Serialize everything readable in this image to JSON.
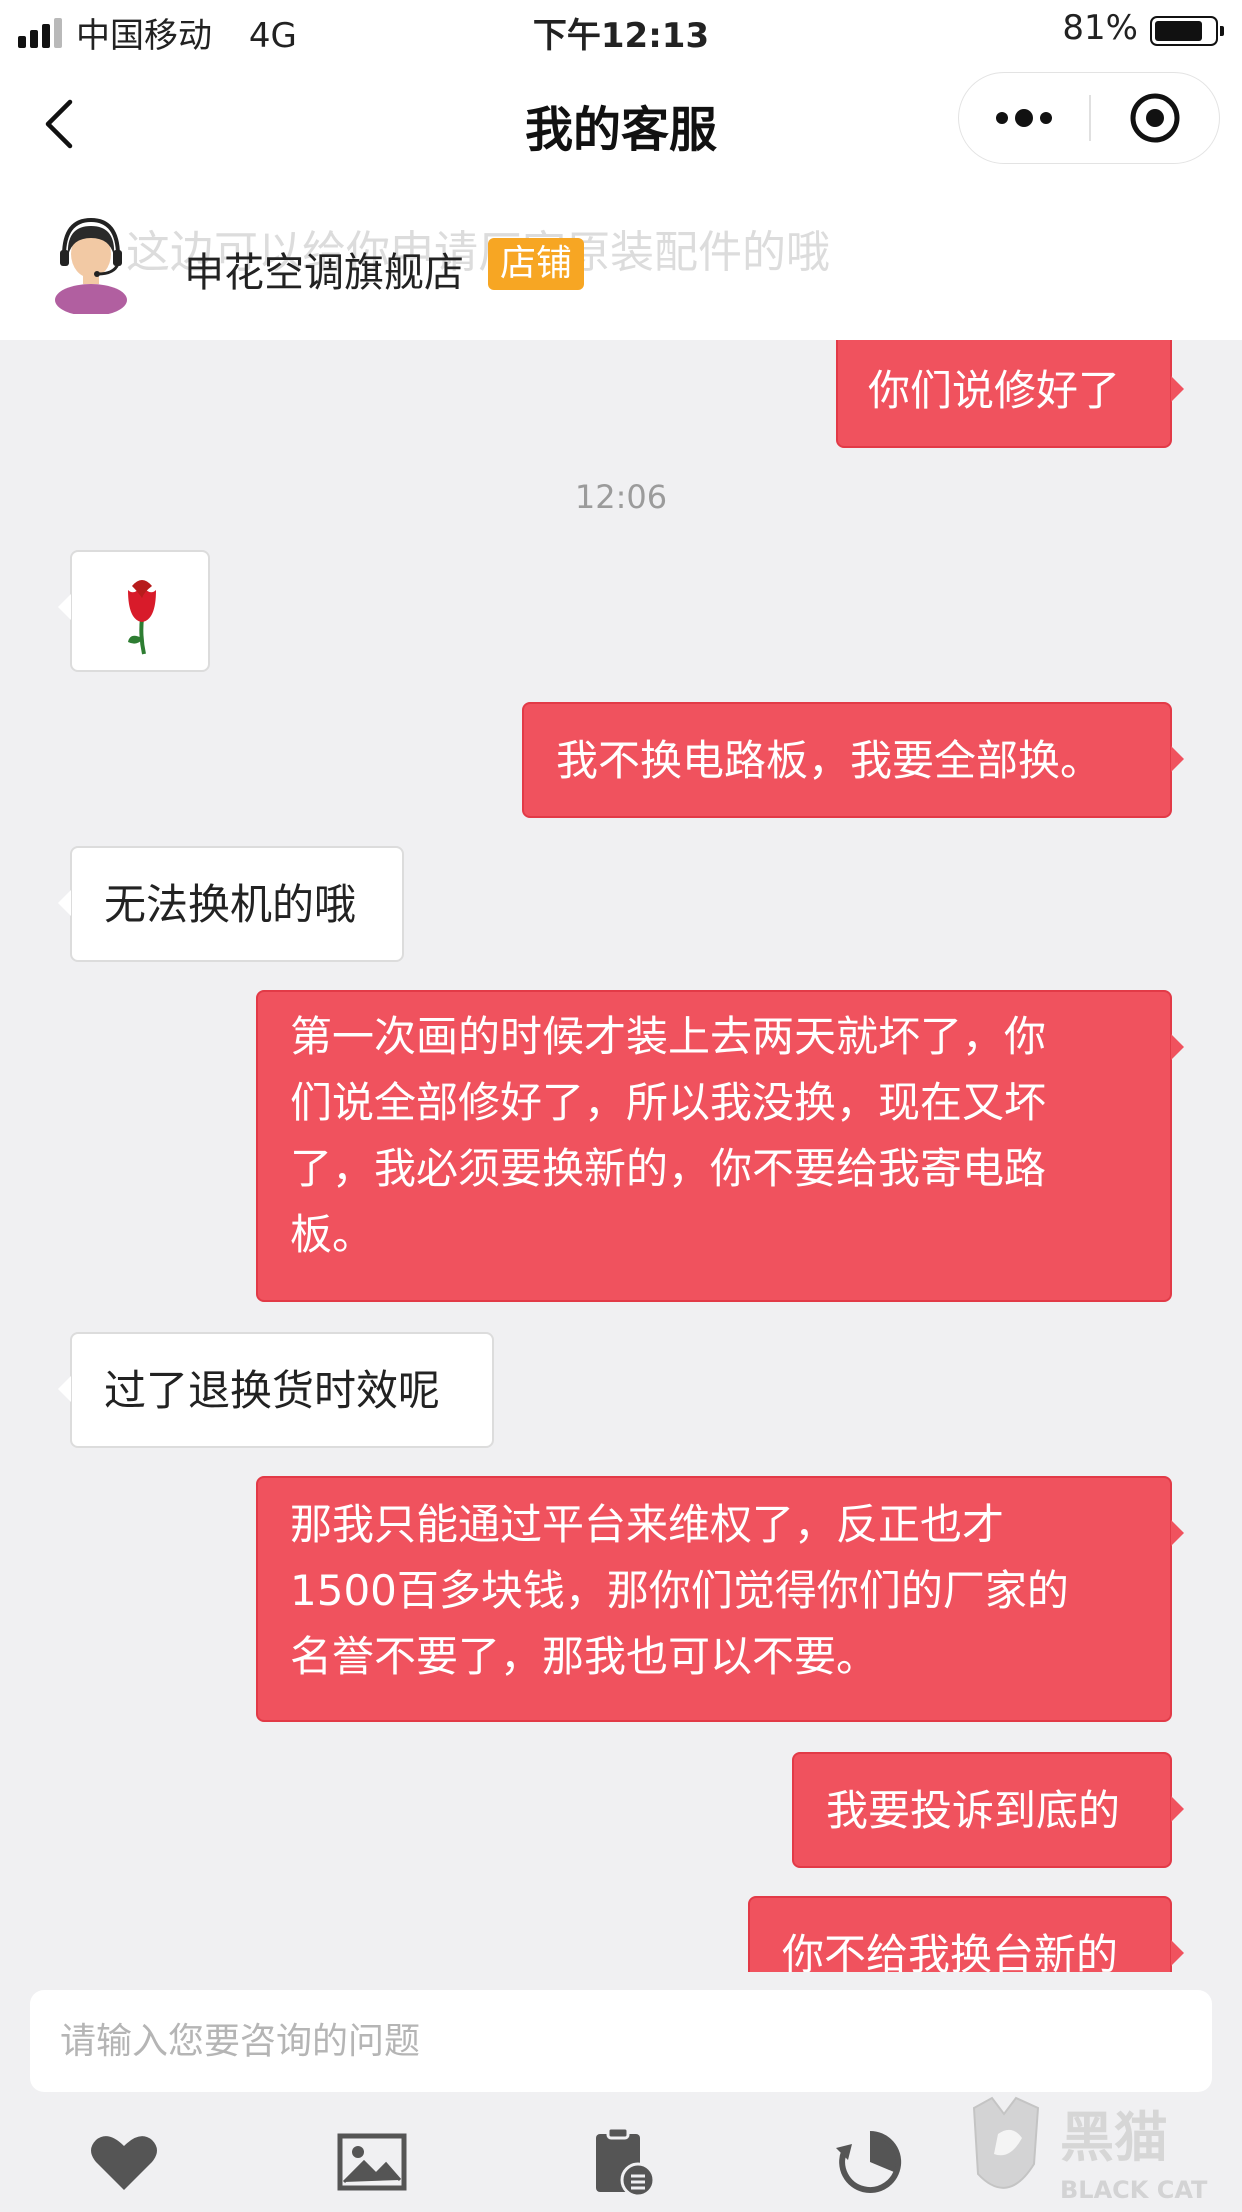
{
  "status_bar": {
    "carrier": "中国移动",
    "network": "4G",
    "time": "下午12:13",
    "battery_percent": "81%",
    "battery_level": 0.81
  },
  "nav": {
    "title": "我的客服",
    "back_icon": "chevron-left-icon",
    "more_icon": "more-dots-icon",
    "close_icon": "target-circle-icon"
  },
  "shop": {
    "name": "申花空调旗舰店",
    "tag": "店铺",
    "ghost_text": "这边可以给你申请厂家原装配件的哦",
    "avatar_icon": "agent-avatar-icon"
  },
  "messages": [
    {
      "from": "me",
      "text": "你们说修好了"
    },
    {
      "type": "timestamp",
      "text": "12:06"
    },
    {
      "from": "other",
      "type": "emoji",
      "icon": "rose-icon"
    },
    {
      "from": "me",
      "text": "我不换电路板，我要全部换。"
    },
    {
      "from": "other",
      "text": "无法换机的哦"
    },
    {
      "from": "me",
      "lines": [
        "第一次画的时候才装上去两天就坏了，你",
        "们说全部修好了，所以我没换，现在又坏",
        "了，我必须要换新的，你不要给我寄电路",
        "板。"
      ]
    },
    {
      "from": "other",
      "text": "过了退换货时效呢"
    },
    {
      "from": "me",
      "lines": [
        "那我只能通过平台来维权了，反正也才",
        "1500百多块钱，那你们觉得你们的厂家的",
        "名誉不要了，那我也可以不要。"
      ]
    },
    {
      "from": "me",
      "text": "我要投诉到底的"
    },
    {
      "from": "me",
      "text": "你不给我换台新的"
    }
  ],
  "input": {
    "placeholder": "请输入您要咨询的问题"
  },
  "toolbar": [
    {
      "icon": "heart-icon"
    },
    {
      "icon": "image-icon"
    },
    {
      "icon": "order-clipboard-icon"
    },
    {
      "icon": "history-icon"
    }
  ],
  "watermark": {
    "text_cn": "黑猫",
    "text_en": "BLACK CAT"
  },
  "colors": {
    "my_bubble": "#f0525e",
    "other_bubble": "#ffffff",
    "tag_orange": "#f7a623",
    "background": "#f0f0f2"
  }
}
